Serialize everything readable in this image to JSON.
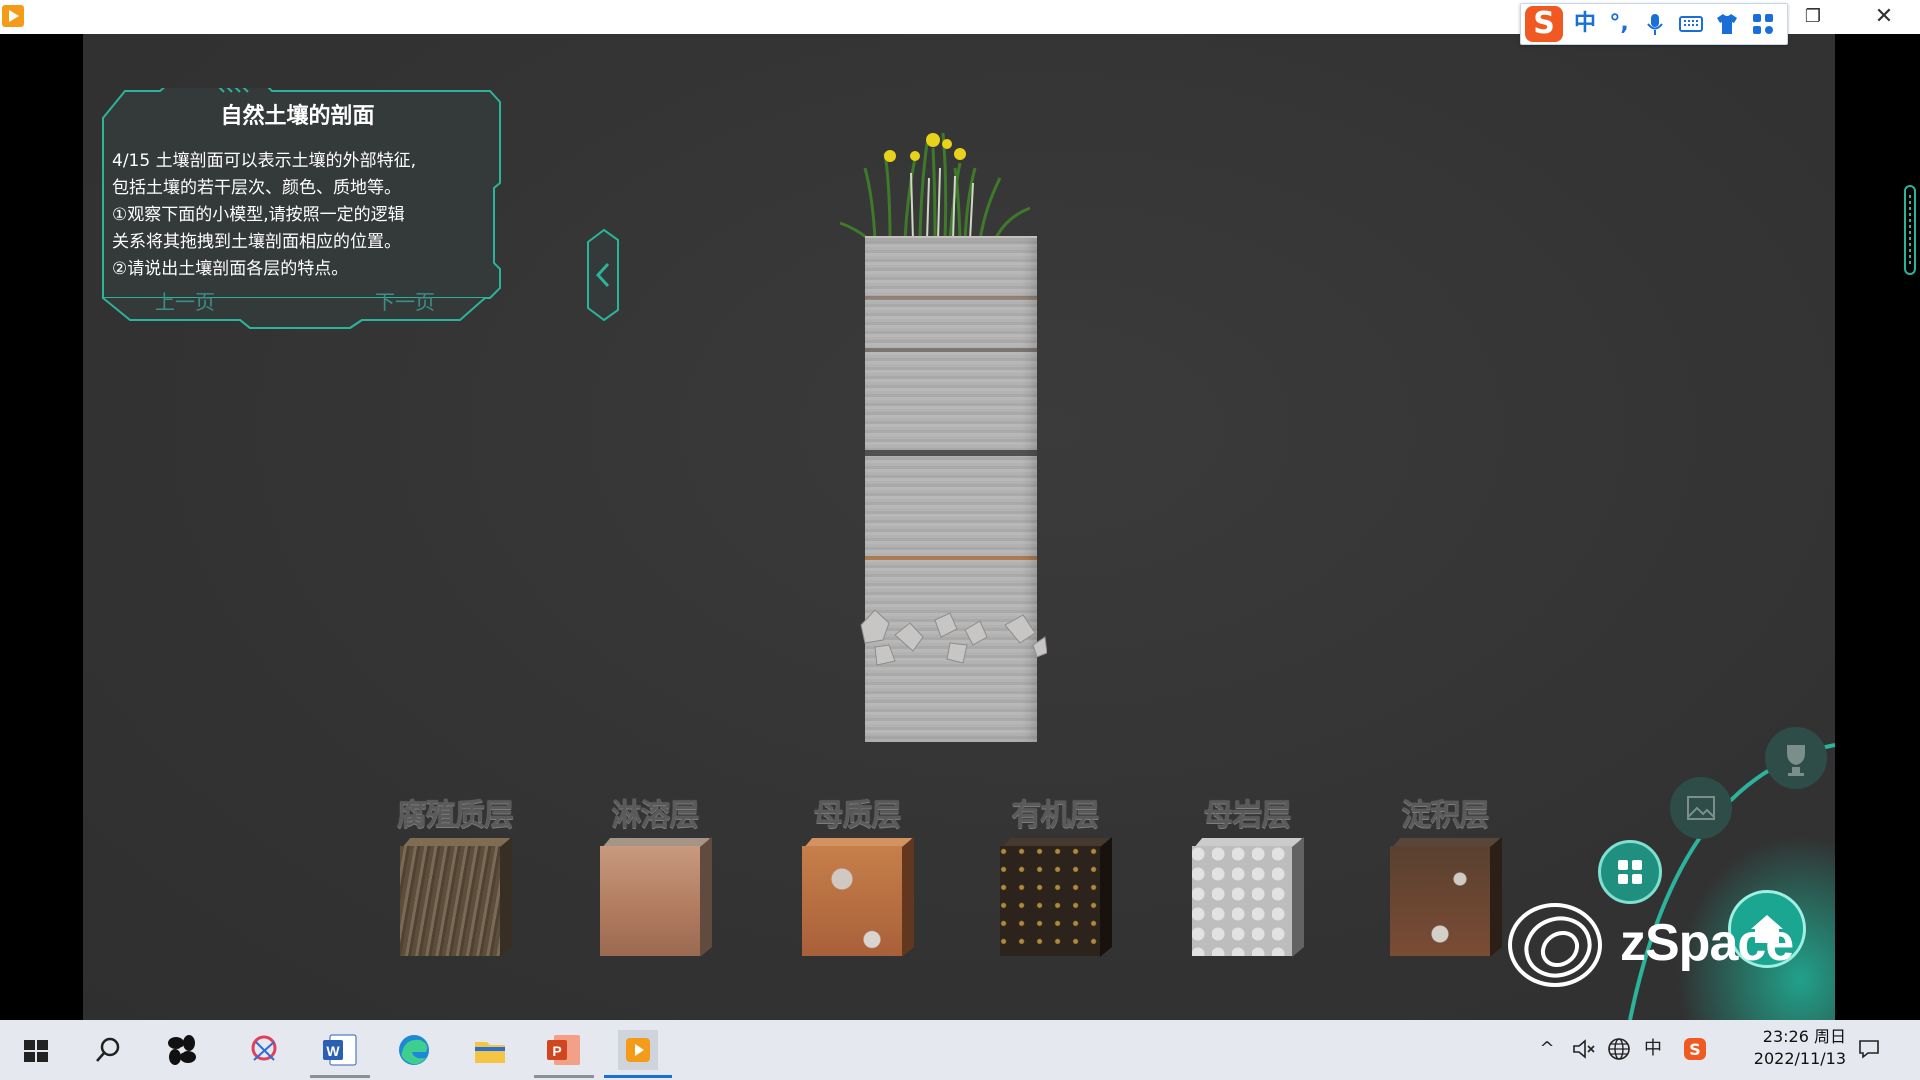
{
  "panel": {
    "title": "自然土壤的剖面",
    "lines": [
      "4/15 土壤剖面可以表示土壤的外部特征,",
      "包括土壤的若干层次、颜色、质地等。",
      "①观察下面的小模型,请按照一定的逻辑",
      "关系将其拖拽到土壤剖面相应的位置。",
      "②请说出土壤剖面各层的特点。"
    ],
    "prev_label": "上一页",
    "next_label": "下一页",
    "collapse_icon": "chevron-left-icon"
  },
  "layers": [
    {
      "label": "腐殖质层",
      "texture": "humus"
    },
    {
      "label": "淋溶层",
      "texture": "eluvial"
    },
    {
      "label": "母质层",
      "texture": "parent-material"
    },
    {
      "label": "有机层",
      "texture": "organic"
    },
    {
      "label": "母岩层",
      "texture": "bedrock"
    },
    {
      "label": "淀积层",
      "texture": "illuvial"
    }
  ],
  "ime": {
    "logo": "S",
    "mode": "中",
    "punct": "°,",
    "icons": [
      "microphone-icon",
      "keyboard-icon",
      "skin-icon",
      "toolbox-icon"
    ]
  },
  "brand": {
    "name": "zSpace"
  },
  "taskbar": {
    "apps": [
      "windows-start-icon",
      "search-icon",
      "fan-app-icon",
      "snipping-icon",
      "word-icon",
      "edge-icon",
      "file-explorer-icon",
      "powerpoint-icon",
      "media-player-icon"
    ],
    "tray": {
      "ime_mode": "中",
      "time": "23:26 周日",
      "date": "2022/11/13"
    }
  },
  "colors": {
    "accent": "#2bb39c",
    "panel_bg": "#363a3b",
    "background": "#333333"
  }
}
